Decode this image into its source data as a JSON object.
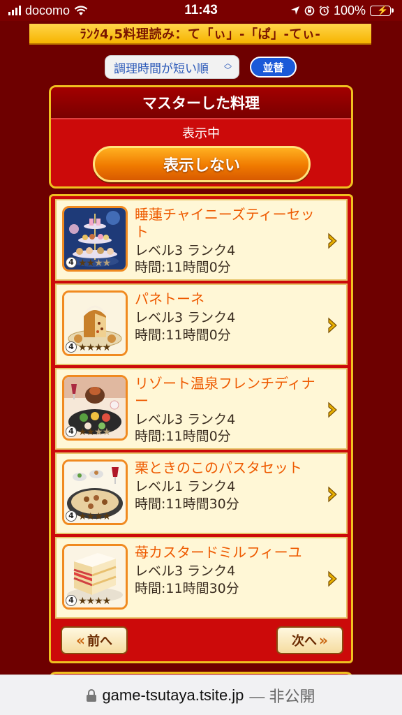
{
  "status_bar": {
    "carrier": "docomo",
    "time": "11:43",
    "battery": "100%"
  },
  "banner": "ﾗﾝｸ4,5料理読み：て「ぃ」-「ぱ」-てぃ-",
  "sort": {
    "selected": "調理時間が短い順",
    "button": "並替"
  },
  "master": {
    "title": "マスターした料理",
    "status": "表示中",
    "toggle_button": "表示しない"
  },
  "recipes": [
    {
      "name": "睡蓮チャイニーズティーセット",
      "level": "レベル3 ランク4",
      "time": "時間:11時間0分",
      "rank": "4",
      "stars_filled": 2,
      "image": "chinese-tea-set-image"
    },
    {
      "name": "パネトーネ",
      "level": "レベル3 ランク4",
      "time": "時間:11時間0分",
      "rank": "4",
      "stars_filled": 4,
      "image": "panettone-image"
    },
    {
      "name": "リゾート温泉フレンチディナー",
      "level": "レベル3 ランク4",
      "time": "時間:11時間0分",
      "rank": "4",
      "stars_filled": 2,
      "image": "french-dinner-image"
    },
    {
      "name": "栗ときのこのパスタセット",
      "level": "レベル1 ランク4",
      "time": "時間:11時間30分",
      "rank": "4",
      "stars_filled": 4,
      "image": "pasta-set-image"
    },
    {
      "name": "苺カスタードミルフィーユ",
      "level": "レベル3 ランク4",
      "time": "時間:11時間30分",
      "rank": "4",
      "stars_filled": 4,
      "image": "mille-feuille-image"
    }
  ],
  "pagination": {
    "prev": "前へ",
    "next": "次へ"
  },
  "browser": {
    "domain": "game-tsutaya.tsite.jp",
    "suffix": "— 非公開"
  },
  "colors": {
    "background": "#6e0000",
    "panel_red": "#cc0a0a",
    "gold_border": "#f0c020",
    "recipe_name": "#ee5a00"
  }
}
